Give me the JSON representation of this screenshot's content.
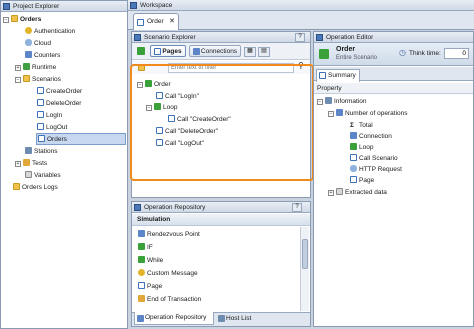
{
  "project_explorer": {
    "title": "Project Explorer",
    "root": "Orders",
    "items": [
      {
        "label": "Authentication",
        "icon": "key-icon",
        "level": 1
      },
      {
        "label": "Cloud",
        "icon": "cloud-icon",
        "level": 1
      },
      {
        "label": "Counters",
        "icon": "counter-icon",
        "level": 1
      },
      {
        "label": "Runtime",
        "icon": "runtime-icon",
        "level": 1
      },
      {
        "label": "Scenarios",
        "icon": "folder-icon",
        "level": 1
      },
      {
        "label": "CreateOrder",
        "icon": "scenario-icon",
        "level": 2
      },
      {
        "label": "DeleteOrder",
        "icon": "scenario-icon",
        "level": 2
      },
      {
        "label": "LogIn",
        "icon": "scenario-icon",
        "level": 2
      },
      {
        "label": "LogOut",
        "icon": "scenario-icon",
        "level": 2
      },
      {
        "label": "Orders",
        "icon": "scenario-icon",
        "level": 2
      },
      {
        "label": "Stations",
        "icon": "station-icon",
        "level": 1
      },
      {
        "label": "Tests",
        "icon": "test-icon",
        "level": 1
      },
      {
        "label": "Variables",
        "icon": "variable-icon",
        "level": 1
      }
    ],
    "bottom_item": "Orders Logs"
  },
  "workspace": {
    "title": "Workspace",
    "tab": "Order"
  },
  "scenario_explorer": {
    "title": "Scenario Explorer",
    "pages_label": "Pages",
    "connections_label": "Connections",
    "search_placeholder": "Enter text to filter",
    "tree": [
      {
        "label": "Order",
        "level": 0
      },
      {
        "label": "Call \"LogIn\"",
        "level": 1
      },
      {
        "label": "Loop",
        "level": 1
      },
      {
        "label": "Call \"CreateOrder\"",
        "level": 2
      },
      {
        "label": "Call \"DeleteOrder\"",
        "level": 1
      },
      {
        "label": "Call \"LogOut\"",
        "level": 1
      }
    ]
  },
  "operation_repository": {
    "title": "Operation Repository",
    "section": "Simulation",
    "items": [
      "Rendezvous Point",
      "IF",
      "While",
      "Custom Message",
      "Page",
      "End of Transaction"
    ],
    "tabs": [
      "Operation Repository",
      "Host List"
    ]
  },
  "operation_editor": {
    "title": "Operation Editor",
    "name": "Order",
    "subtitle": "Entire Scenario",
    "think_time_label": "Think time:",
    "think_time_value": "0",
    "summary_tab": "Summary",
    "property_header": "Property",
    "information": "Information",
    "number_of_operations": "Number of operations",
    "stats": [
      "Total",
      "Connection",
      "Loop",
      "Call Scenario",
      "HTTP Request",
      "Page"
    ],
    "extracted": "Extracted data"
  }
}
